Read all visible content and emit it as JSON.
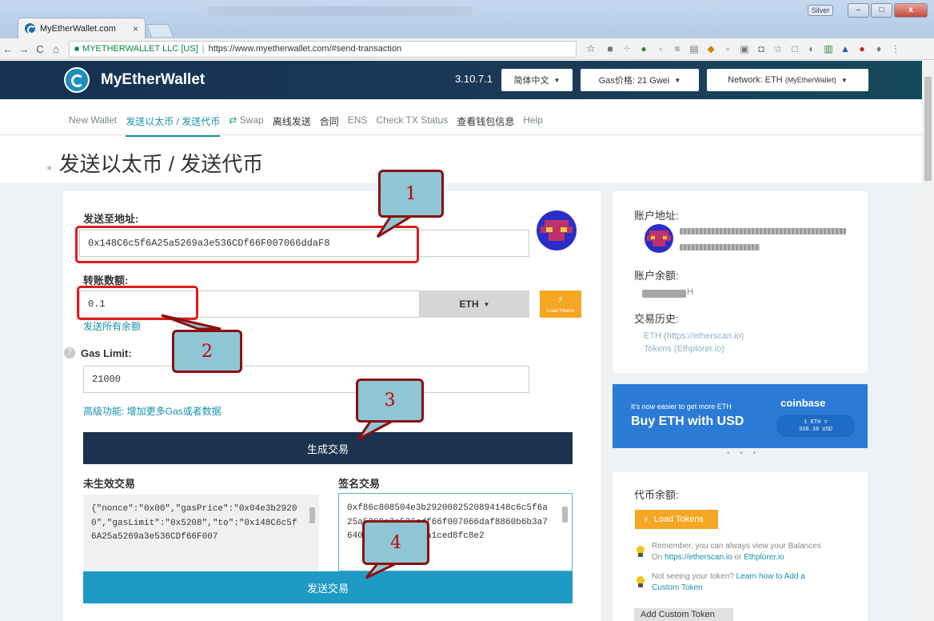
{
  "browser": {
    "tab_title": "MyEtherWallet.com",
    "tab_close": "×",
    "user_badge": "Silver",
    "win_min": "–",
    "win_max": "□",
    "win_close": "x",
    "nav_back": "←",
    "nav_forward": "→",
    "nav_reload": "C",
    "nav_home": "⌂",
    "secure_label": "MYETHERWALLET LLC [US]",
    "url": "https://www.myetherwallet.com/#send-transaction",
    "star": "☆",
    "menu": "⋮"
  },
  "header": {
    "brand": "MyEtherWallet",
    "version": "3.10.7.1",
    "language": "简体中文",
    "gas_price": "Gas价格: 21 Gwei",
    "network_label": "Network: ETH",
    "network_sub": "(MyEtherWallet)"
  },
  "nav": {
    "items": [
      "New Wallet",
      "发送以太币 / 发送代币",
      "Swap",
      "离线发送",
      "合同",
      "ENS",
      "Check TX Status",
      "查看钱包信息",
      "Help"
    ]
  },
  "page": {
    "title": "发送以太币 / 发送代币",
    "plus": "+"
  },
  "form": {
    "to_label": "发送至地址:",
    "to_value": "0x148C6c5f6A25a5269a3e536CDf66F007066ddaF8",
    "amount_label": "转账数额:",
    "amount_value": "0.1",
    "unit": "ETH",
    "load_tokens_small": "Load Tokens",
    "send_all": "发送所有余额",
    "gas_limit_label": "Gas Limit:",
    "gas_limit_value": "21000",
    "advanced": "高级功能: 增加更多Gas或者数据",
    "generate_button": "生成交易",
    "raw_label": "未生效交易",
    "raw_value": "{\"nonce\":\"0x00\",\"gasPrice\":\"0x04e3b29200\",\"gasLimit\":\"0x5208\",\"to\":\"0x148C6c5f6A25a5269a3e536CDf66F007",
    "signed_label": "签名交易",
    "signed_value": "0xf86c808504e3b2920082520894148c6c5f6a25a5269a3e536cdf66f007066daf8860b6b3a76400008025a00dda1ced8fc8e2",
    "send_button": "发送交易"
  },
  "sidebar": {
    "account_address_label": "账户地址:",
    "account_balance_label": "账户余额:",
    "balance_suffix": "H",
    "history_label": "交易历史:",
    "history_links": [
      "ETH (https://etherscan.io)",
      "Tokens (Ethplorer.io)"
    ],
    "ad_small": "It's now easier to get more ETH",
    "ad_big": "Buy ETH with USD",
    "ad_brand": "coinbase",
    "ad_rate_1": "1 ETH =",
    "ad_rate_2": "338.38 USD",
    "ad_dots": "• • •",
    "token_balance_label": "代币余额:",
    "load_tokens": "Load Tokens",
    "tip1_a": "Remember, you can always view your Balances",
    "tip1_b": "On",
    "tip1_link1": "https://etherscan.io",
    "tip1_or": "or",
    "tip1_link2": "Ethplorer.io",
    "tip2_a": "Not seeing your token?",
    "tip2_link": "Learn how to Add a Custom Token",
    "add_custom": "Add Custom Token"
  },
  "callouts": [
    "1",
    "2",
    "3",
    "4"
  ],
  "colors": {
    "header_bg": "#163151",
    "accent": "#168fae",
    "generate_btn": "#1c3350",
    "send_btn": "#1e9ac4",
    "orange": "#f5a623",
    "coinbase": "#2b7bd6",
    "annotation_red": "#e01b1b"
  }
}
